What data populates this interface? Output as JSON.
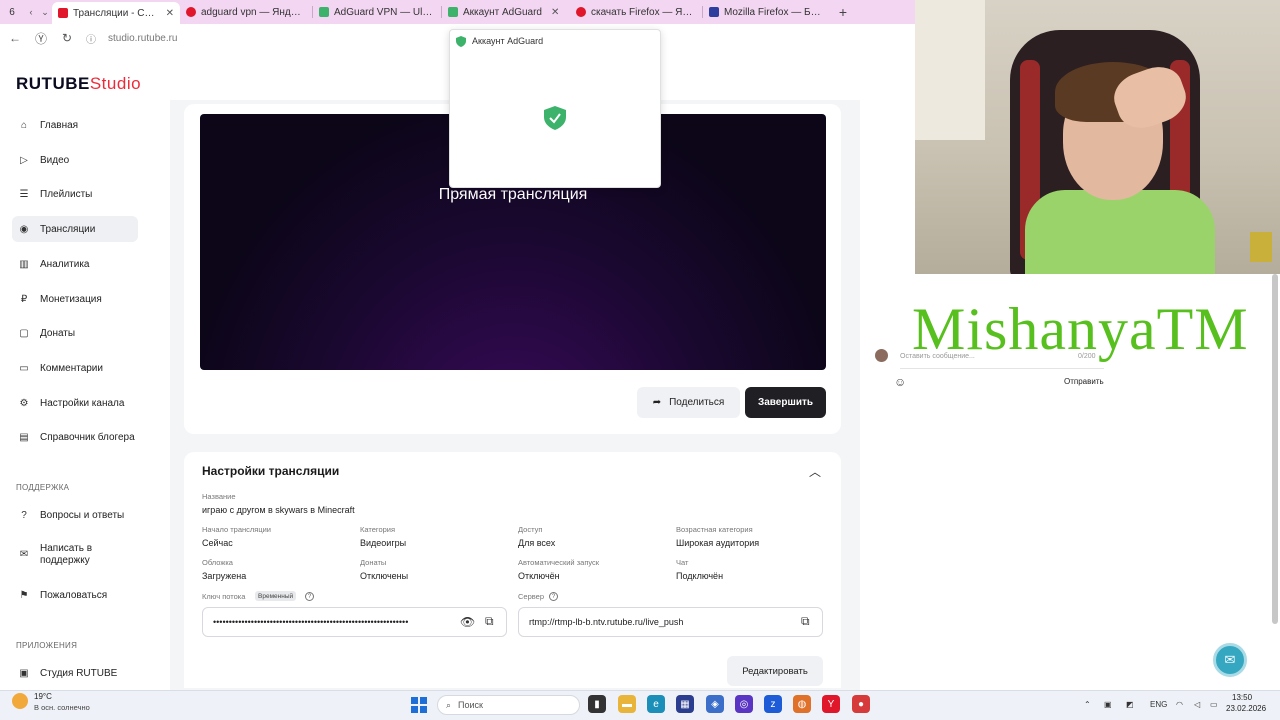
{
  "browser": {
    "tab_count": "6",
    "tabs": [
      {
        "title": "Трансляции - Студия R",
        "color": "#e0162b",
        "active": true
      },
      {
        "title": "adguard vpn — Яндекс:н",
        "color": "#e0162b",
        "active": false
      },
      {
        "title": "AdGuard VPN — Ultimate I",
        "color": "#3db26b",
        "active": false
      },
      {
        "title": "Аккаунт AdGuard",
        "color": "#3db26b",
        "active": false
      },
      {
        "title": "скачать Firefox — Яндекс:",
        "color": "#e0162b",
        "active": false
      },
      {
        "title": "Mozilla Firefox — Бесплат",
        "color": "#2c3e9e",
        "active": false
      }
    ],
    "url": "studio.rutube.ru"
  },
  "popup": {
    "title": "Аккаунт AdGuard"
  },
  "app": {
    "logo_main": "RUTUBE",
    "logo_studio": "Studio"
  },
  "sidebar": {
    "items": [
      {
        "label": "Главная",
        "icon": "home-icon"
      },
      {
        "label": "Видео",
        "icon": "video-icon"
      },
      {
        "label": "Плейлисты",
        "icon": "playlist-icon"
      },
      {
        "label": "Трансляции",
        "icon": "broadcast-icon"
      },
      {
        "label": "Аналитика",
        "icon": "analytics-icon"
      },
      {
        "label": "Монетизация",
        "icon": "monetization-icon"
      },
      {
        "label": "Донаты",
        "icon": "donate-icon"
      },
      {
        "label": "Комментарии",
        "icon": "comments-icon"
      },
      {
        "label": "Настройки канала",
        "icon": "gear-icon"
      },
      {
        "label": "Справочник блогера",
        "icon": "book-icon"
      }
    ],
    "support_heading": "ПОДДЕРЖКА",
    "support_items": [
      {
        "label": "Вопросы и ответы",
        "icon": "question-icon"
      },
      {
        "label": "Написать в поддержку",
        "icon": "mail-icon"
      },
      {
        "label": "Пожаловаться",
        "icon": "flag-icon"
      }
    ],
    "apps_heading": "ПРИЛОЖЕНИЯ",
    "apps_items": [
      {
        "label": "Студия RUTUBE",
        "icon": "studio-app-icon"
      }
    ]
  },
  "player": {
    "title": "Прямая трансляция"
  },
  "actions": {
    "share": "Поделиться",
    "finish": "Завершить",
    "edit": "Редактировать"
  },
  "settings": {
    "heading": "Настройки трансляции",
    "name_label": "Название",
    "name_value": "играю с другом в skywars в Minecraft",
    "fields": [
      {
        "label": "Начало трансляции",
        "value": "Сейчас"
      },
      {
        "label": "Категория",
        "value": "Видеоигры"
      },
      {
        "label": "Доступ",
        "value": "Для всех"
      },
      {
        "label": "Возрастная категория",
        "value": "Широкая аудитория"
      },
      {
        "label": "Обложка",
        "value": "Загружена"
      },
      {
        "label": "Донаты",
        "value": "Отключены"
      },
      {
        "label": "Автоматический запуск",
        "value": "Отключён"
      },
      {
        "label": "Чат",
        "value": "Подключён"
      }
    ],
    "stream_key_label": "Ключ потока",
    "stream_key_badge": "Временный",
    "stream_key_value": "••••••••••••••••••••••••••••••••••••••••••••••••••••••••••••••",
    "server_label": "Сервер",
    "server_value": "rtmp://rtmp-lb-b.ntv.rutube.ru/live_push"
  },
  "chat": {
    "placeholder": "Оставить сообщение...",
    "counter": "0/200",
    "send": "Отправить"
  },
  "overlay": {
    "watermark": "MishanyaTM"
  },
  "taskbar": {
    "temperature": "19°C",
    "weather": "В осн. солнечно",
    "search_placeholder": "Поиск",
    "language": "ENG",
    "time": "13:50",
    "date": "23.02.2026"
  }
}
